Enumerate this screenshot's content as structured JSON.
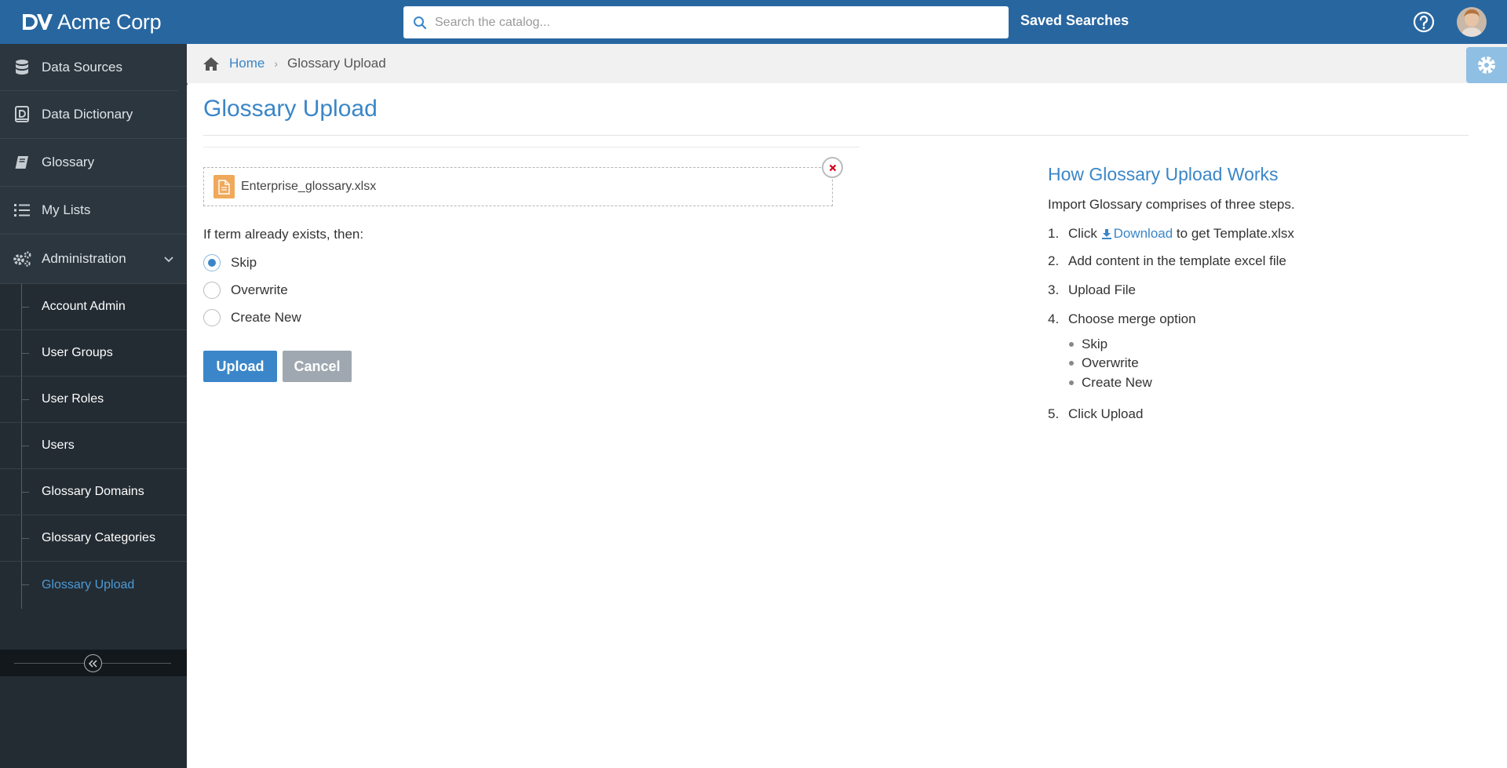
{
  "header": {
    "brand_name": "Acme Corp",
    "search_placeholder": "Search the catalog...",
    "saved_searches": "Saved Searches",
    "accent_color": "#2866a0"
  },
  "sidebar": {
    "items": [
      {
        "label": "Data Sources",
        "icon": "database-icon"
      },
      {
        "label": "Data Dictionary",
        "icon": "dictionary-icon"
      },
      {
        "label": "Glossary",
        "icon": "book-icon"
      },
      {
        "label": "My Lists",
        "icon": "list-icon"
      },
      {
        "label": "Administration",
        "icon": "gears-icon",
        "expanded": true
      }
    ],
    "sub_items": [
      {
        "label": "Account Admin"
      },
      {
        "label": "User Groups"
      },
      {
        "label": "User Roles"
      },
      {
        "label": "Users"
      },
      {
        "label": "Glossary Domains"
      },
      {
        "label": "Glossary Categories"
      },
      {
        "label": "Glossary Upload",
        "active": true
      }
    ]
  },
  "breadcrumb": {
    "home": "Home",
    "current": "Glossary Upload"
  },
  "main": {
    "title": "Glossary Upload",
    "file_name": "Enterprise_glossary.xlsx",
    "question": "If term already exists, then:",
    "options": [
      {
        "label": "Skip",
        "checked": true
      },
      {
        "label": "Overwrite",
        "checked": false
      },
      {
        "label": "Create New",
        "checked": false
      }
    ],
    "upload_label": "Upload",
    "cancel_label": "Cancel"
  },
  "help": {
    "title": "How Glossary Upload Works",
    "intro": "Import Glossary comprises of three steps.",
    "step1_num": "1.",
    "step1_pre": "Click",
    "step1_link": "Download",
    "step1_post": "to get Template.xlsx",
    "step2_num": "2.",
    "step2": "Add content in the template excel file",
    "step3_num": "3.",
    "step3": "Upload File",
    "step4_num": "4.",
    "step4": "Choose merge option",
    "merge_options": [
      "Skip",
      "Overwrite",
      "Create New"
    ],
    "step5_num": "5.",
    "step5": "Click Upload"
  }
}
